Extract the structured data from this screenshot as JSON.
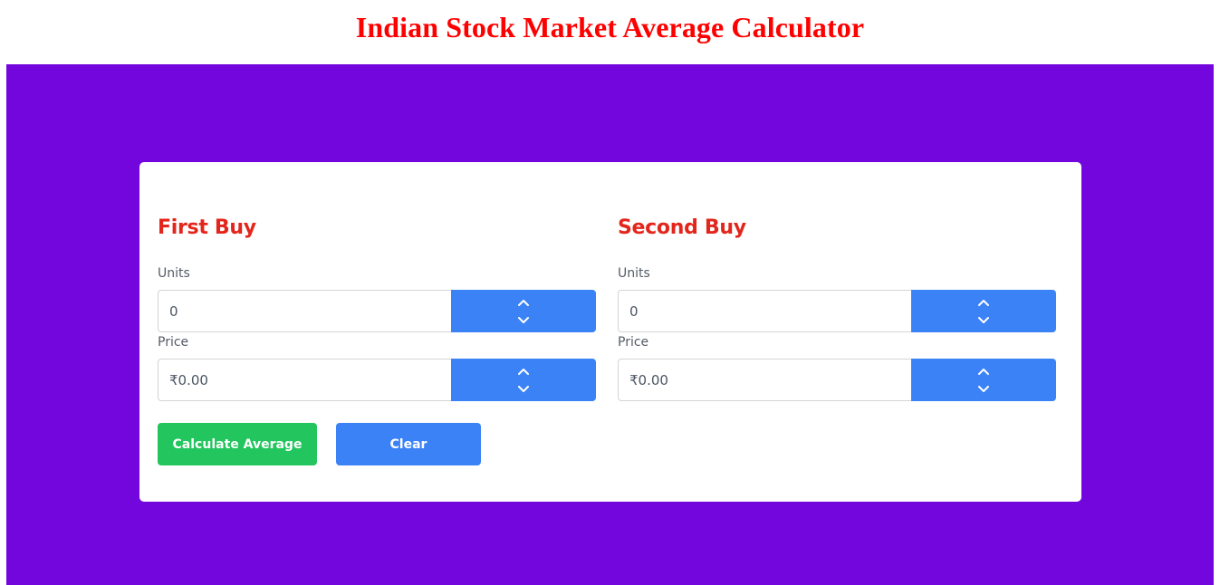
{
  "header": {
    "title": "Indian Stock Market Average Calculator"
  },
  "colors": {
    "title": "#ff0000",
    "band": "#7306dc",
    "section_title": "#e3261b",
    "stepper": "#3b82f6",
    "calculate_button": "#22c55e",
    "clear_button": "#3b82f6"
  },
  "first_buy": {
    "title": "First Buy",
    "units": {
      "label": "Units",
      "value": "0"
    },
    "price": {
      "label": "Price",
      "value": "₹0.00"
    }
  },
  "second_buy": {
    "title": "Second Buy",
    "units": {
      "label": "Units",
      "value": "0"
    },
    "price": {
      "label": "Price",
      "value": "₹0.00"
    }
  },
  "actions": {
    "calculate_label": "Calculate Average",
    "clear_label": "Clear"
  },
  "icons": {
    "increment": "chevron-up-icon",
    "decrement": "chevron-down-icon"
  }
}
